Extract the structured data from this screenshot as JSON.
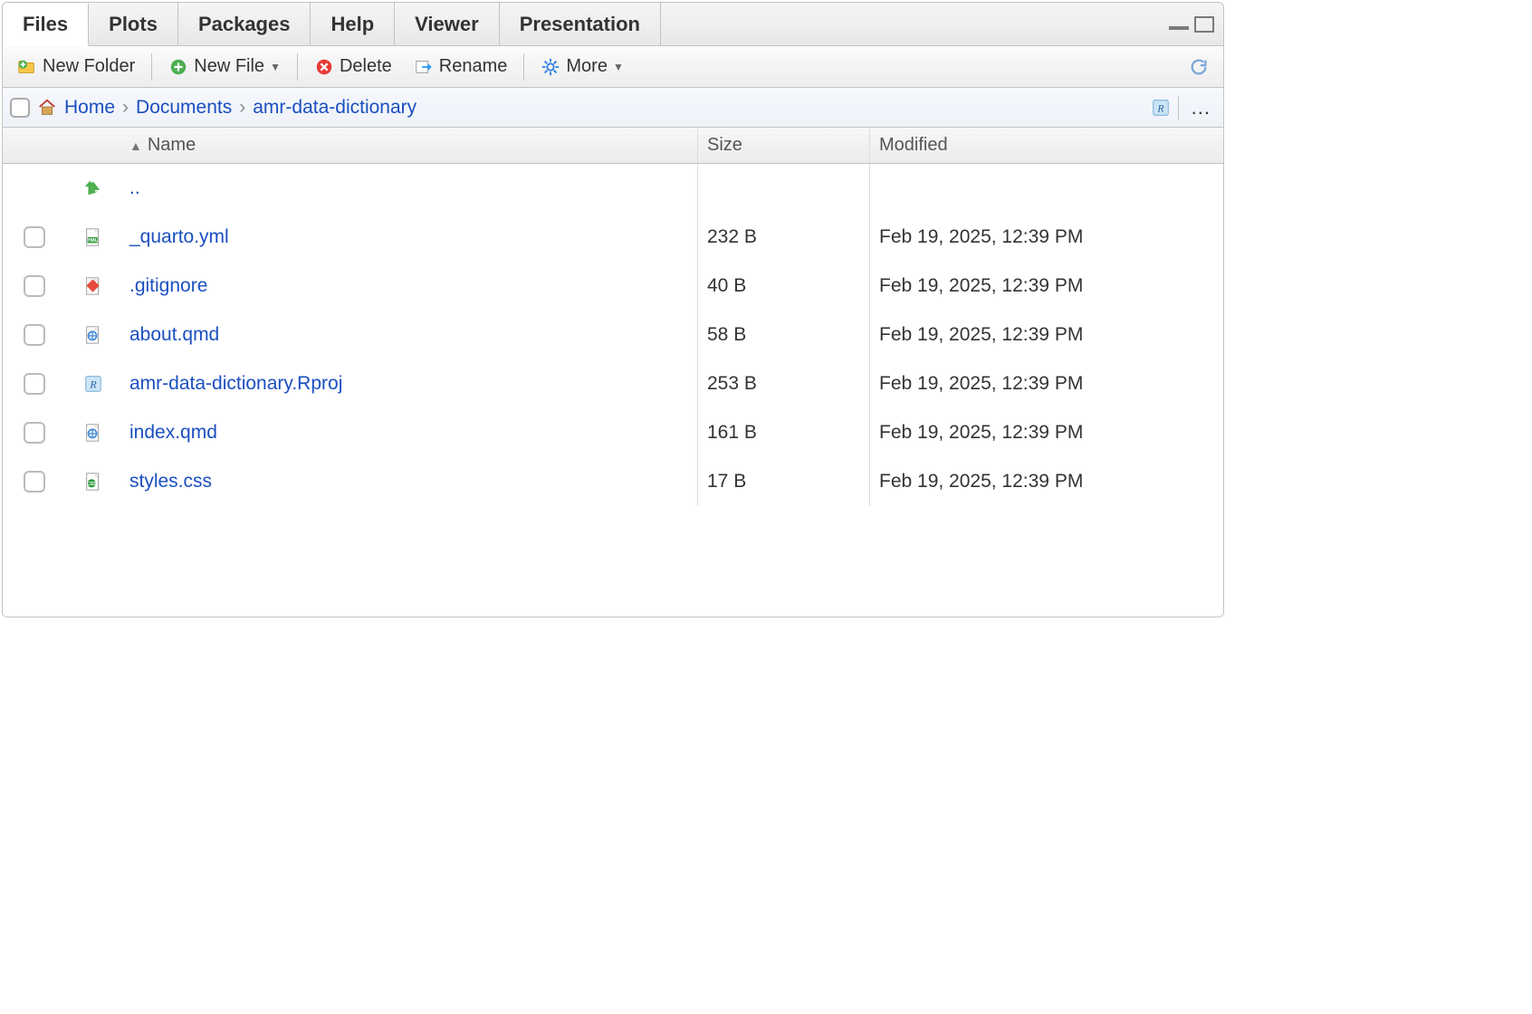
{
  "tabs": {
    "files": "Files",
    "plots": "Plots",
    "packages": "Packages",
    "help": "Help",
    "viewer": "Viewer",
    "presentation": "Presentation"
  },
  "toolbar": {
    "new_folder": "New Folder",
    "new_file": "New File",
    "delete": "Delete",
    "rename": "Rename",
    "more": "More"
  },
  "breadcrumb": {
    "home": "Home",
    "documents": "Documents",
    "project": "amr-data-dictionary"
  },
  "headers": {
    "name": "Name",
    "size": "Size",
    "modified": "Modified"
  },
  "updir": "..",
  "files": [
    {
      "name": "_quarto.yml",
      "size": "232 B",
      "modified": "Feb 19, 2025, 12:39 PM",
      "icon": "yml"
    },
    {
      "name": ".gitignore",
      "size": "40 B",
      "modified": "Feb 19, 2025, 12:39 PM",
      "icon": "git"
    },
    {
      "name": "about.qmd",
      "size": "58 B",
      "modified": "Feb 19, 2025, 12:39 PM",
      "icon": "qmd"
    },
    {
      "name": "amr-data-dictionary.Rproj",
      "size": "253 B",
      "modified": "Feb 19, 2025, 12:39 PM",
      "icon": "rproj"
    },
    {
      "name": "index.qmd",
      "size": "161 B",
      "modified": "Feb 19, 2025, 12:39 PM",
      "icon": "qmd"
    },
    {
      "name": "styles.css",
      "size": "17 B",
      "modified": "Feb 19, 2025, 12:39 PM",
      "icon": "css"
    }
  ]
}
